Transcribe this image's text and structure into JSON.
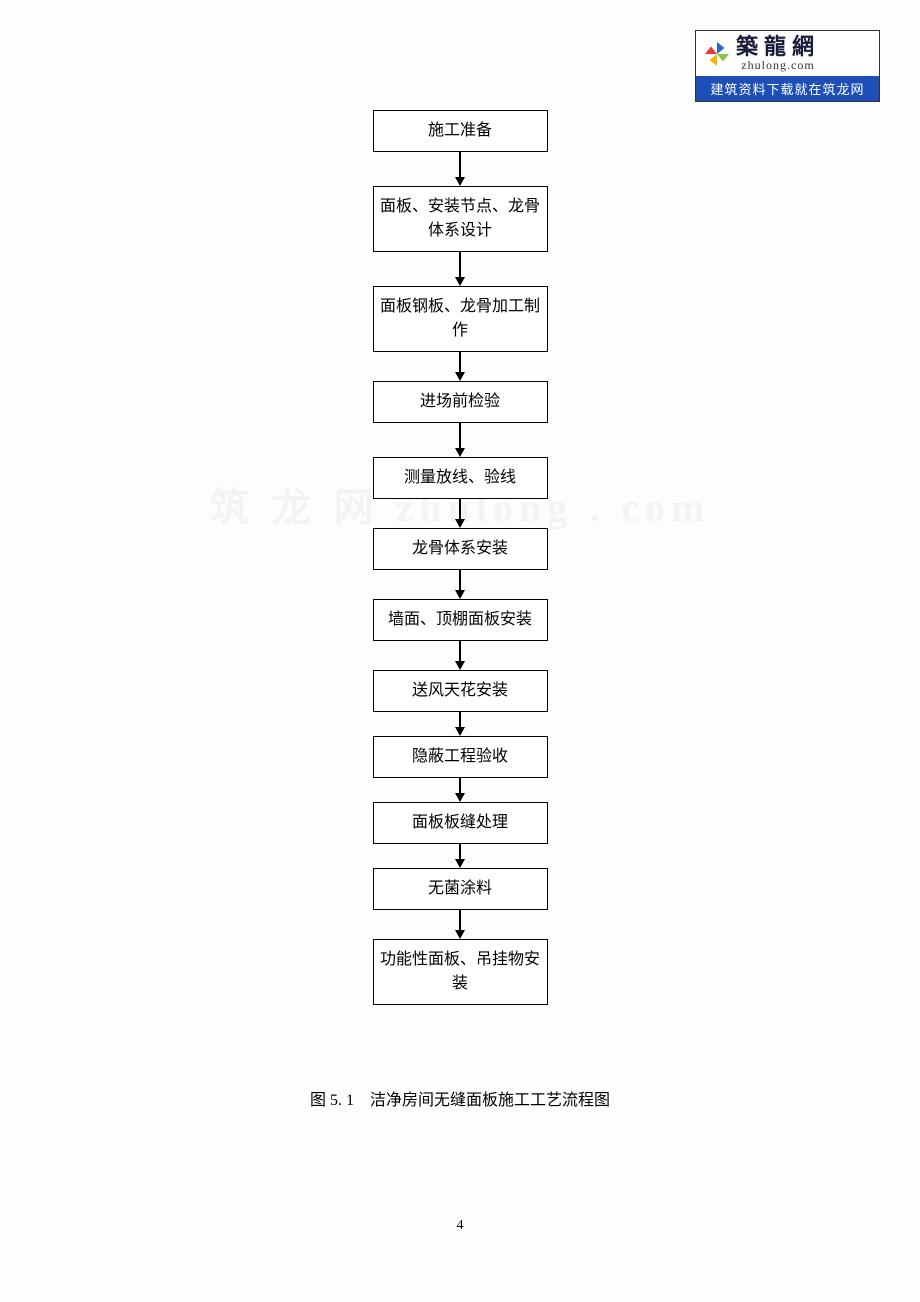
{
  "logo": {
    "title": "築龍網",
    "domain": "zhulong.com",
    "banner": "建筑资料下载就在筑龙网"
  },
  "chart_data": {
    "type": "flowchart",
    "direction": "top-to-bottom",
    "nodes": [
      {
        "id": "n1",
        "label": "施工准备"
      },
      {
        "id": "n2",
        "label": "面板、安装节点、龙骨体系设计"
      },
      {
        "id": "n3",
        "label": "面板钢板、龙骨加工制作"
      },
      {
        "id": "n4",
        "label": "进场前检验"
      },
      {
        "id": "n5",
        "label": "测量放线、验线"
      },
      {
        "id": "n6",
        "label": "龙骨体系安装"
      },
      {
        "id": "n7",
        "label": "墙面、顶棚面板安装"
      },
      {
        "id": "n8",
        "label": "送风天花安装"
      },
      {
        "id": "n9",
        "label": "隐蔽工程验收"
      },
      {
        "id": "n10",
        "label": "面板板缝处理"
      },
      {
        "id": "n11",
        "label": "无菌涂料"
      },
      {
        "id": "n12",
        "label": "功能性面板、吊挂物安装"
      }
    ],
    "edges": [
      [
        "n1",
        "n2"
      ],
      [
        "n2",
        "n3"
      ],
      [
        "n3",
        "n4"
      ],
      [
        "n4",
        "n5"
      ],
      [
        "n5",
        "n6"
      ],
      [
        "n6",
        "n7"
      ],
      [
        "n7",
        "n8"
      ],
      [
        "n8",
        "n9"
      ],
      [
        "n9",
        "n10"
      ],
      [
        "n10",
        "n11"
      ],
      [
        "n11",
        "n12"
      ]
    ]
  },
  "caption": "图 5. 1　洁净房间无缝面板施工工艺流程图",
  "page_number": "4",
  "watermark": "筑 龙 网 zhulong . com"
}
